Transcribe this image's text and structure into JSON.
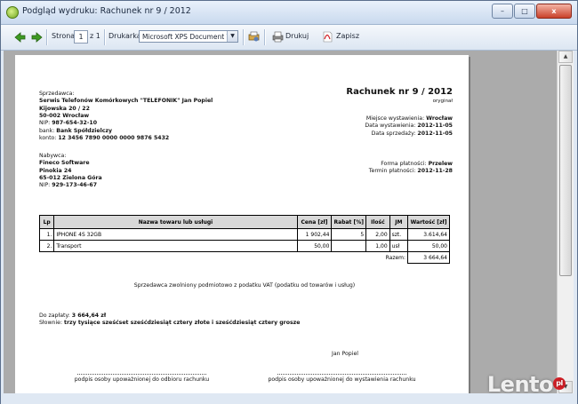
{
  "window": {
    "title": "Podgląd wydruku: Rachunek nr 9 / 2012",
    "min": "–",
    "max": "□",
    "close": "x"
  },
  "toolbar": {
    "page_label": "Strona",
    "page_value": "1",
    "page_of": "z 1",
    "printer_label": "Drukarka",
    "printer_value": "Microsoft XPS Document Writer",
    "print_label": "Drukuj",
    "save_label": "Zapisz"
  },
  "invoice": {
    "seller_label": "Sprzedawca:",
    "seller_name": "Serwis Telefonów Komórkowych \"TELEFONIK\" Jan Popiel",
    "seller_street": "Kijowska 20 / 22",
    "seller_city": "50-002 Wrocław",
    "seller_nip_label": "NIP:",
    "seller_nip": "987-654-32-10",
    "bank_label": "bank:",
    "bank": "Bank Spółdzielczy",
    "account_label": "konto:",
    "account": "12 3456 7890 0000 0000 9876 5432",
    "title": "Rachunek nr 9 / 2012",
    "copy": "oryginał",
    "place_label": "Miejsce wystawienia:",
    "place": "Wrocław",
    "issue_label": "Data wystawienia:",
    "issue_date": "2012-11-05",
    "sale_label": "Data sprzedaży:",
    "sale_date": "2012-11-05",
    "buyer_label": "Nabywca:",
    "buyer_name": "Fineco Software",
    "buyer_street": "Pinokia 24",
    "buyer_city": "65-012 Zielona Góra",
    "buyer_nip_label": "NIP:",
    "buyer_nip": "929-173-46-67",
    "payment_label": "Forma płatności:",
    "payment": "Przelew",
    "due_label": "Termin płatności:",
    "due_date": "2012-11-28",
    "headers": [
      "Lp",
      "Nazwa towaru lub usługi",
      "Cena [zł]",
      "Rabat [%]",
      "Ilość",
      "JM",
      "Wartość [zł]"
    ],
    "rows": [
      [
        "1.",
        "IPHONE 4S 32GB",
        "1 902,44",
        "5",
        "2,00",
        "szt.",
        "3.614,64"
      ],
      [
        "2.",
        "Transport",
        "50,00",
        "",
        "1,00",
        "usł",
        "50,00"
      ]
    ],
    "total_label": "Razem:",
    "total": "3 664,64",
    "vat_note": "Sprzedawca zwolniony podmiotowo z podatku VAT (podatku od towarów i usług)",
    "due_amount_label": "Do zapłaty:",
    "due_amount": "3 664,64 zł",
    "words_label": "Słownie:",
    "words": "trzy tysiące sześćset sześćdziesiąt cztery złote i sześćdziesiąt cztery grosze",
    "signer": "Jan Popiel",
    "sign_receive": "podpis osoby upoważnionej do odbioru rachunku",
    "sign_issue": "podpis osoby upoważnionej do wystawienia rachunku"
  },
  "watermark": {
    "text": "Lento",
    "badge": "pl"
  },
  "colors": {
    "accent_green": "#3e9a22",
    "close_red": "#c9402a",
    "watermark_red": "#d11f26"
  }
}
